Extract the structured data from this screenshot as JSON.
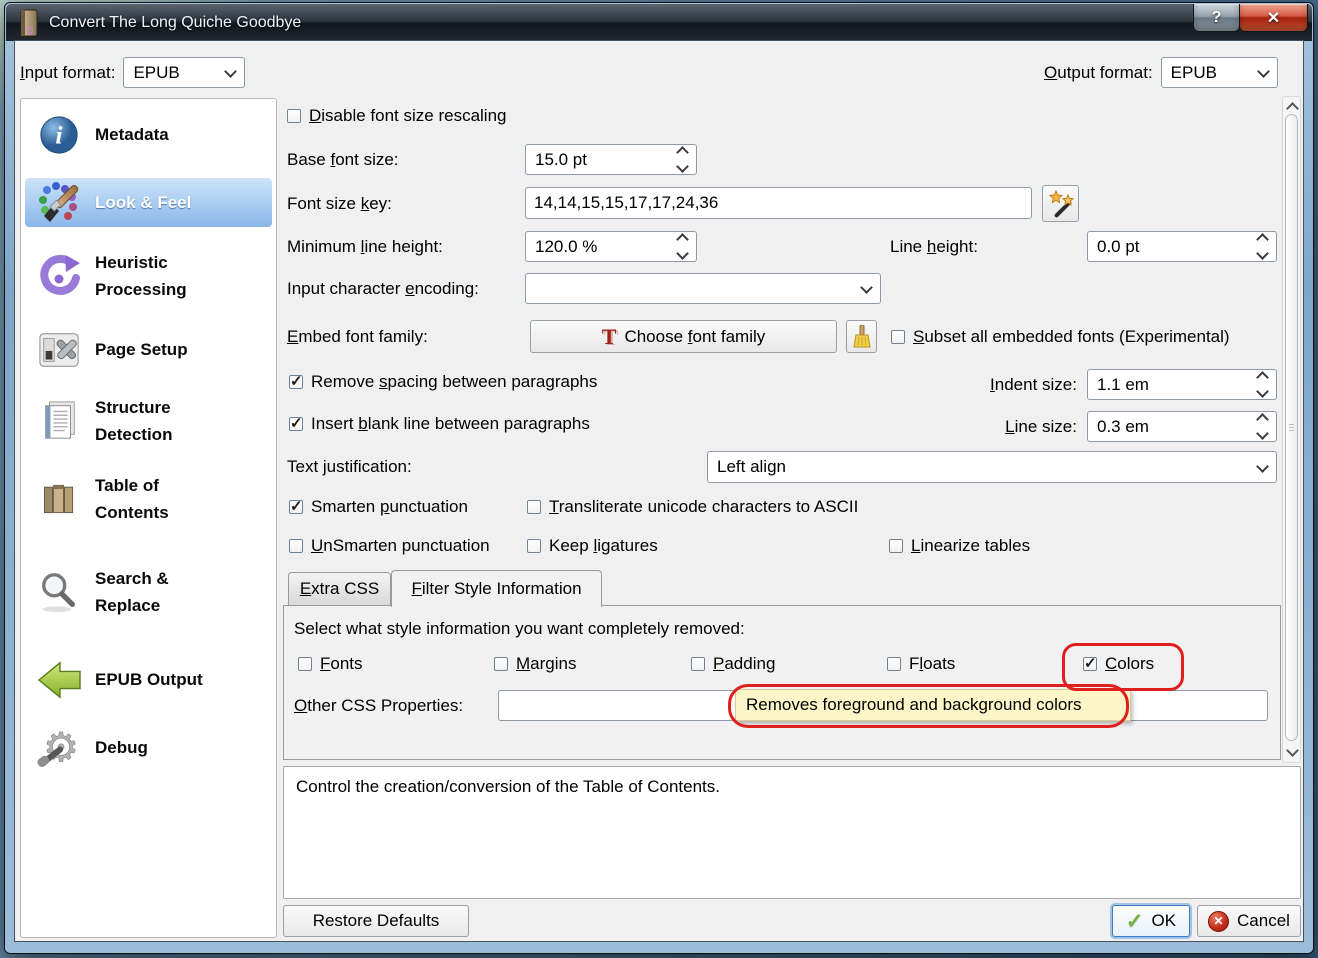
{
  "window": {
    "title": "Convert The Long Quiche Goodbye",
    "help_label": "?",
    "close_label": "✕"
  },
  "format_bar": {
    "input_label": "&Input format:",
    "input_value": "EPUB",
    "output_label": "&Output format:",
    "output_value": "EPUB"
  },
  "sidebar": {
    "selected": "Look & Feel",
    "items": [
      {
        "label": "Metadata",
        "icon": "info-icon"
      },
      {
        "label": "Look & Feel",
        "icon": "paintbrush-icon"
      },
      {
        "label": "Heuristic Processing",
        "icon": "refresh-arrow-icon"
      },
      {
        "label": "Page Setup",
        "icon": "page-setup-icon"
      },
      {
        "label": "Structure Detection",
        "icon": "document-icon"
      },
      {
        "label": "Table of Contents",
        "icon": "books-icon"
      },
      {
        "label": "Search & Replace",
        "icon": "magnifier-icon"
      },
      {
        "label": "EPUB Output",
        "icon": "green-arrow-icon"
      },
      {
        "label": "Debug",
        "icon": "gear-icon"
      }
    ]
  },
  "main": {
    "disable_rescaling": {
      "label": "&Disable font size rescaling",
      "checked": false
    },
    "base_font_size": {
      "label": "Base &font size:",
      "value": "15.0 pt"
    },
    "font_size_key": {
      "label": "Font size &key:",
      "value": "14,14,15,15,17,17,24,36"
    },
    "min_line_height": {
      "label": "Minimum &line height:",
      "value": "120.0 %"
    },
    "line_height": {
      "label": "Line &height:",
      "value": "0.0 pt"
    },
    "input_encoding": {
      "label": "Input character &encoding:",
      "value": ""
    },
    "embed_font": {
      "label": "&Embed font family:",
      "button_label": "Choose &font family"
    },
    "subset_fonts": {
      "label": "&Subset all embedded fonts (Experimental)",
      "checked": false
    },
    "remove_spacing": {
      "label": "Remove &spacing between paragraphs",
      "checked": true
    },
    "indent_size": {
      "label": "&Indent size:",
      "value": "1.1 em"
    },
    "insert_blank": {
      "label": "Insert &blank line between paragraphs",
      "checked": true
    },
    "line_size": {
      "label": "&Line size:",
      "value": "0.3 em"
    },
    "text_justification": {
      "label": "Text justification:",
      "value": "Left align"
    },
    "smarten_punctuation": {
      "label": "Smarten &punctuation",
      "checked": true
    },
    "transliterate": {
      "label": "&Transliterate unicode characters to ASCII",
      "checked": false
    },
    "unsmarten_punctuation": {
      "label": "&UnSmarten punctuation",
      "checked": false
    },
    "keep_ligatures": {
      "label": "Keep &ligatures",
      "checked": false
    },
    "linearize_tables": {
      "label": "&Linearize tables",
      "checked": false
    },
    "tabs": [
      {
        "label": "&Extra CSS",
        "active": false
      },
      {
        "label": "&Filter Style Information",
        "active": true
      }
    ],
    "filter_panel": {
      "heading": "Select what style information you want completely removed:",
      "options": [
        {
          "label": "&Fonts",
          "checked": false
        },
        {
          "label": "&Margins",
          "checked": false
        },
        {
          "label": "&Padding",
          "checked": false
        },
        {
          "label": "F&loats",
          "checked": false
        },
        {
          "label": "&Colors",
          "checked": true
        }
      ],
      "other_css_label": "&Other CSS Properties:",
      "other_css_value": "",
      "tooltip": "Removes foreground and background colors"
    }
  },
  "info_box": {
    "text": "Control the creation/conversion of the Table of Contents."
  },
  "footer": {
    "restore_defaults": "Restore Defaults",
    "ok": "OK",
    "cancel": "Cancel"
  },
  "colors": {
    "sidebar_selection": "#8ab7e9",
    "annotation_red": "#e01f1f",
    "tooltip_bg": "#fbf5c8",
    "close_button_red": "#c23b2a",
    "ok_focus_blue": "#3d7bbf",
    "client_bg": "#f0f0f0"
  }
}
